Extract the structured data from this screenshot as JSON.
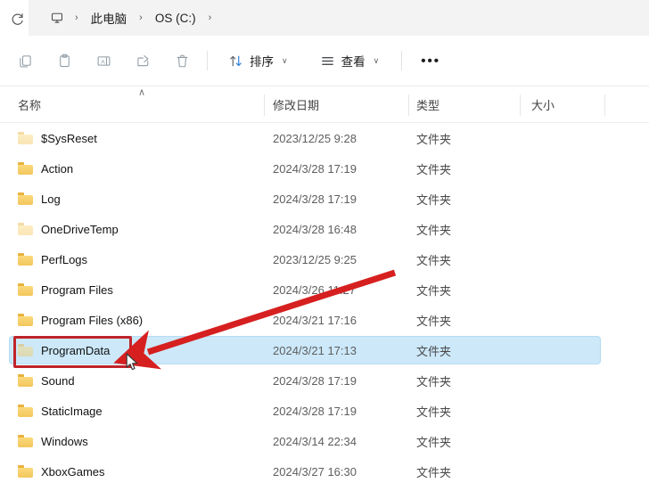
{
  "window": {
    "title": "OS (C:)"
  },
  "addressbar": {
    "refresh_icon": "refresh-icon",
    "pc_icon": "this-pc-monitor-icon",
    "separator": "›",
    "crumbs": [
      {
        "label": "此电脑",
        "name": "breadcrumb-this-pc"
      },
      {
        "label": "OS (C:)",
        "name": "breadcrumb-os-c"
      }
    ]
  },
  "toolbar": {
    "icons": [
      {
        "name": "copy-icon",
        "label": "复制"
      },
      {
        "name": "paste-icon",
        "label": "粘贴"
      },
      {
        "name": "rename-icon",
        "label": "重命名"
      },
      {
        "name": "share-icon",
        "label": "共享"
      },
      {
        "name": "delete-icon",
        "label": "删除"
      }
    ],
    "sort": {
      "label": "排序",
      "icon": "sort-arrows-icon",
      "caret": "∨"
    },
    "view": {
      "label": "查看",
      "icon": "view-lines-icon",
      "caret": "∨"
    },
    "more": {
      "label": "•••",
      "name": "more-options-button"
    }
  },
  "columns": {
    "sort_indicator": "∧",
    "headers": [
      {
        "label": "名称",
        "name": "column-header-name"
      },
      {
        "label": "修改日期",
        "name": "column-header-date-modified"
      },
      {
        "label": "类型",
        "name": "column-header-type"
      },
      {
        "label": "大小",
        "name": "column-header-size"
      }
    ]
  },
  "files": [
    {
      "name": "$SysReset",
      "date": "2023/12/25 9:28",
      "type": "文件夹",
      "size": "",
      "hidden": true,
      "selected": false
    },
    {
      "name": "Action",
      "date": "2024/3/28 17:19",
      "type": "文件夹",
      "size": "",
      "hidden": false,
      "selected": false
    },
    {
      "name": "Log",
      "date": "2024/3/28 17:19",
      "type": "文件夹",
      "size": "",
      "hidden": false,
      "selected": false
    },
    {
      "name": "OneDriveTemp",
      "date": "2024/3/28 16:48",
      "type": "文件夹",
      "size": "",
      "hidden": true,
      "selected": false
    },
    {
      "name": "PerfLogs",
      "date": "2023/12/25 9:25",
      "type": "文件夹",
      "size": "",
      "hidden": false,
      "selected": false
    },
    {
      "name": "Program Files",
      "date": "2024/3/26 11:27",
      "type": "文件夹",
      "size": "",
      "hidden": false,
      "selected": false
    },
    {
      "name": "Program Files (x86)",
      "date": "2024/3/21 17:16",
      "type": "文件夹",
      "size": "",
      "hidden": false,
      "selected": false
    },
    {
      "name": "ProgramData",
      "date": "2024/3/21 17:13",
      "type": "文件夹",
      "size": "",
      "hidden": true,
      "selected": true
    },
    {
      "name": "Sound",
      "date": "2024/3/28 17:19",
      "type": "文件夹",
      "size": "",
      "hidden": false,
      "selected": false
    },
    {
      "name": "StaticImage",
      "date": "2024/3/28 17:19",
      "type": "文件夹",
      "size": "",
      "hidden": false,
      "selected": false
    },
    {
      "name": "Windows",
      "date": "2024/3/14 22:34",
      "type": "文件夹",
      "size": "",
      "hidden": false,
      "selected": false
    },
    {
      "name": "XboxGames",
      "date": "2024/3/27 16:30",
      "type": "文件夹",
      "size": "",
      "hidden": false,
      "selected": false
    }
  ],
  "annotations": {
    "highlight_color": "#c0232a",
    "box_target": "ProgramData",
    "arrow_target": "ProgramData"
  },
  "colors": {
    "selection": "#cce8f9",
    "folder": "#f2c65c",
    "addressbar_bg": "#f3f3f3"
  }
}
